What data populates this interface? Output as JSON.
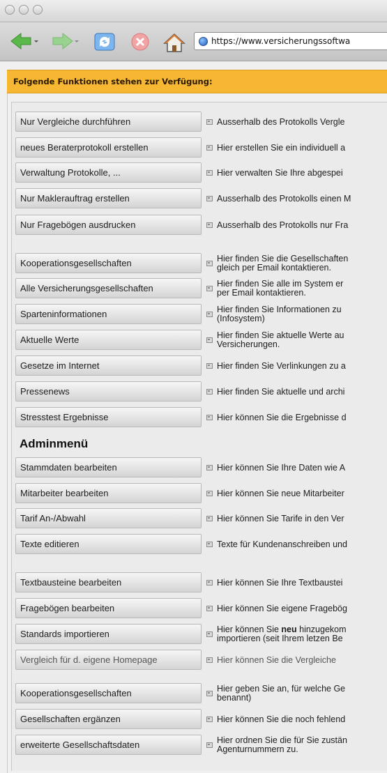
{
  "toolbar": {
    "url": "https://www.versicherungssoftwa"
  },
  "banner": {
    "text": "Folgende Funktionen stehen zur Verfügung:"
  },
  "admin_heading": "Adminmenü",
  "rows": [
    {
      "label": "Nur Vergleiche durchführen",
      "desc": [
        "Ausserhalb des Protokolls Vergle"
      ]
    },
    {
      "label": "neues Beraterprotokoll erstellen",
      "desc": [
        "Hier erstellen Sie ein individuell a"
      ]
    },
    {
      "label": "Verwaltung Protokolle, ...",
      "desc": [
        "Hier verwalten Sie Ihre abgespei"
      ]
    },
    {
      "label": "Nur Maklerauftrag erstellen",
      "desc": [
        "Ausserhalb des Protokolls einen M"
      ]
    },
    {
      "label": "Nur Fragebögen ausdrucken",
      "desc": [
        "Ausserhalb des Protokolls nur Fra"
      ]
    },
    {
      "label": "Kooperationsgesellschaften",
      "desc": [
        "Hier finden Sie die Gesellschaften",
        "gleich per Email kontaktieren."
      ]
    },
    {
      "label": "Alle Versicherungsgesellschaften",
      "desc": [
        "Hier finden Sie alle im System er",
        "per Email kontaktieren."
      ]
    },
    {
      "label": "Sparteninformationen",
      "desc": [
        "Hier finden Sie Informationen zu",
        "(Infosystem)"
      ]
    },
    {
      "label": "Aktuelle Werte",
      "desc": [
        "Hier finden Sie aktuelle Werte au",
        "Versicherungen."
      ]
    },
    {
      "label": "Gesetze im Internet",
      "desc": [
        "Hier finden Sie Verlinkungen zu a"
      ]
    },
    {
      "label": "Pressenews",
      "desc": [
        "Hier finden Sie aktuelle und archi"
      ]
    },
    {
      "label": "Stresstest Ergebnisse",
      "desc": [
        "Hier können Sie die Ergebnisse d"
      ]
    },
    {
      "label": "Stammdaten bearbeiten",
      "desc": [
        "Hier können Sie Ihre Daten wie A"
      ]
    },
    {
      "label": "Mitarbeiter bearbeiten",
      "desc": [
        "Hier können Sie neue Mitarbeiter"
      ]
    },
    {
      "label": "Tarif An-/Abwahl",
      "desc": [
        "Hier können Sie Tarife in den Ver"
      ]
    },
    {
      "label": "Texte editieren",
      "desc": [
        "Texte für Kundenanschreiben und"
      ]
    },
    {
      "label": "Textbausteine bearbeiten",
      "desc": [
        "Hier können Sie Ihre Textbaustei"
      ]
    },
    {
      "label": "Fragebögen bearbeiten",
      "desc": [
        "Hier können Sie eigene Fragebög"
      ]
    },
    {
      "label": "Standards importieren",
      "desc": [
        "Hier können Sie neu hinzugekom",
        "importieren (seit Ihrem letzen Be"
      ]
    },
    {
      "label": "Vergleich für d. eigene Homepage",
      "desc": [
        "Hier können Sie die Vergleiche"
      ]
    },
    {
      "label": "Kooperationsgesellschaften",
      "desc": [
        "Hier geben Sie an, für welche Ge",
        "benannt)"
      ]
    },
    {
      "label": "Gesellschaften ergänzen",
      "desc": [
        "Hier können Sie die noch fehlend"
      ]
    },
    {
      "label": "erweiterte Gesellschaftsdaten",
      "desc": [
        "Hier ordnen Sie die für Sie zustän",
        "Agenturnummern zu."
      ]
    }
  ]
}
